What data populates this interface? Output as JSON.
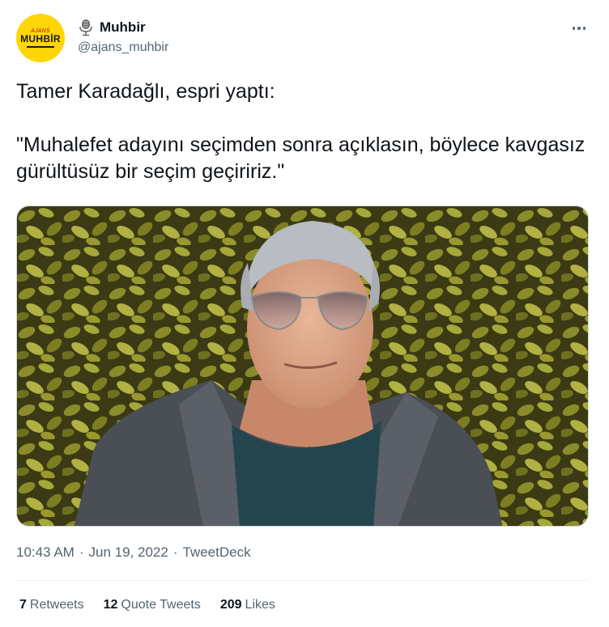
{
  "account": {
    "name": "Muhbir",
    "handle": "@ajans_muhbir",
    "avatar_text_small": "AJANS",
    "avatar_text_big": "MUHBİR",
    "avatar_color": "#ffd60a",
    "name_icon": "microphone-icon"
  },
  "menu": {
    "icon": "more-options-icon"
  },
  "tweet": {
    "text": "Tamer Karadağlı, espri yaptı:\n\n\"Muhalefet adayını seçimden sonra açıklasın, böylece kavgasız gürültüsüz bir seçim geçiririz.\""
  },
  "media": {
    "description_icon": "photo-man-with-sunglasses-leaf-background"
  },
  "meta": {
    "time": "10:43 AM",
    "separator": "·",
    "date": "Jun 19, 2022",
    "source": "TweetDeck"
  },
  "stats": {
    "retweets_count": "7",
    "retweets_label": "Retweets",
    "quotes_count": "12",
    "quotes_label": "Quote Tweets",
    "likes_count": "209",
    "likes_label": "Likes"
  },
  "colors": {
    "text_primary": "#0f1419",
    "text_secondary": "#536471",
    "divider": "#eff3f4"
  }
}
